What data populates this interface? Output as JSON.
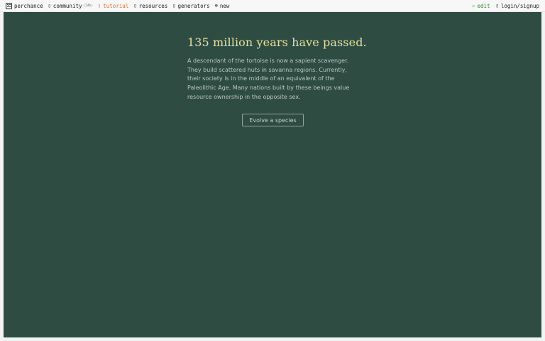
{
  "nav": {
    "left": [
      {
        "id": "perchance",
        "label": "perchance",
        "icon": "dice-icon"
      },
      {
        "id": "community",
        "label": "community",
        "sub": "(24h)",
        "icon": "chat-icon"
      },
      {
        "id": "tutorial",
        "label": "tutorial",
        "icon": "book-icon",
        "color": "#d6772b"
      },
      {
        "id": "resources",
        "label": "resources",
        "icon": "resources-icon"
      },
      {
        "id": "generators",
        "label": "generators",
        "icon": "generators-icon"
      },
      {
        "id": "new",
        "label": "new",
        "icon": "plus-circle-icon"
      }
    ],
    "right": [
      {
        "id": "edit",
        "label": "edit",
        "icon": "pencil-icon",
        "color": "#2e8b2e"
      },
      {
        "id": "login",
        "label": "login/signup",
        "icon": "user-icon"
      }
    ]
  },
  "main": {
    "headline": "135 million years have passed.",
    "description": "A descendant of the tortoise is now a sapient scavenger. They build scattered huts in savanna regions. Currently, their society is in the middle of an equivalent of the Paleolithic Age. Many nations built by these beings value resource ownership in the opposite sex.",
    "button_label": "Evolve a species"
  },
  "colors": {
    "stage_background": "#2f4c43",
    "headline": "#e4e09a",
    "body_text": "#b9c6c0"
  }
}
